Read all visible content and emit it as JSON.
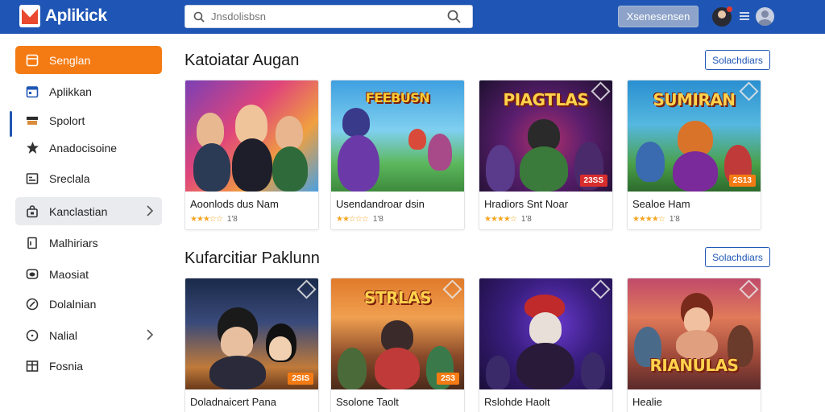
{
  "app": {
    "name": "Aplikick",
    "search_placeholder": "Jnsdolisbsn",
    "header_button": "Xsenesensen"
  },
  "sidebar": {
    "items": [
      {
        "label": "Senglan",
        "icon": "window-icon"
      },
      {
        "label": "Aplikkan",
        "icon": "calendar-icon"
      },
      {
        "label": "Spolort",
        "icon": "layers-icon"
      },
      {
        "label": "Anadocisoine",
        "icon": "star-icon"
      },
      {
        "label": "Sreclala",
        "icon": "grid-icon"
      },
      {
        "label": "Kanclastian",
        "icon": "bag-icon"
      },
      {
        "label": "Malhiriars",
        "icon": "document-icon"
      },
      {
        "label": "Maosiat",
        "icon": "chat-icon"
      },
      {
        "label": "Dolalnian",
        "icon": "tag-icon"
      },
      {
        "label": "Nalial",
        "icon": "clock-icon"
      },
      {
        "label": "Fosnia",
        "icon": "table-icon"
      }
    ]
  },
  "sections": [
    {
      "title": "Katoiatar Augan",
      "button": "Solachdiars",
      "cards": [
        {
          "name": "Aoonlods dus Nam",
          "rating": "1'8",
          "stars": "★★★☆☆"
        },
        {
          "name": "Usendandroar dsin",
          "rating": "1'8",
          "stars": "★★☆☆☆"
        },
        {
          "name": "Hradiors Snt Noar",
          "rating": "1'8",
          "stars": "★★★★☆",
          "badge": "23SS",
          "title": "PIAGTLAS"
        },
        {
          "name": "Sealoe Ham",
          "rating": "1'8",
          "stars": "★★★★☆",
          "badge": "2S13",
          "title": "SUMIRAN"
        }
      ]
    },
    {
      "title": "Kufarcitiar Paklunn",
      "button": "Solachdiars",
      "cards": [
        {
          "name": "Doladnaicert Pana",
          "badge": "2SIS"
        },
        {
          "name": "Ssolone Taolt",
          "badge": "2S3",
          "title": "STRLAS"
        },
        {
          "name": "Rslohde Haolt"
        },
        {
          "name": "Healie",
          "title": "RIANULAS"
        }
      ]
    }
  ],
  "colors": {
    "header": "#1f56b5",
    "accent": "#f47b13",
    "star": "#f5a623"
  }
}
